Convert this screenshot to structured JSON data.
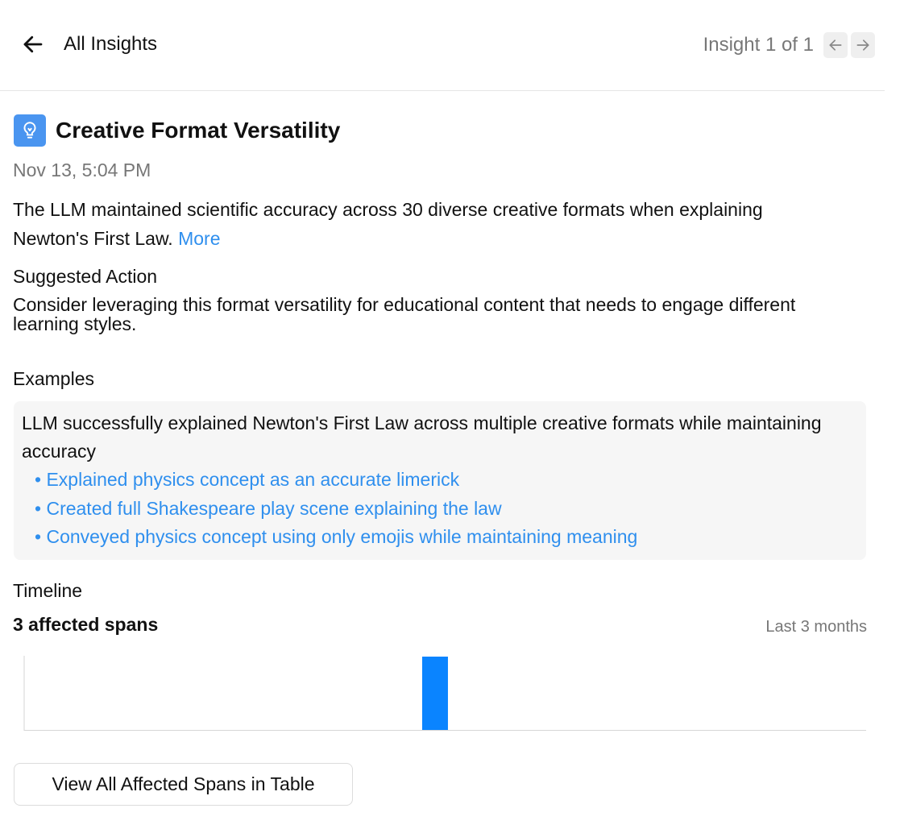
{
  "header": {
    "back_label": "All Insights",
    "pager_text": "Insight 1 of 1"
  },
  "insight": {
    "icon": "lightbulb-icon",
    "title": "Creative Format Versatility",
    "date": "Nov 13, 5:04 PM",
    "description": "The LLM maintained scientific accuracy across 30 diverse creative formats when explaining Newton's First Law.",
    "more_label": "More"
  },
  "suggested_action": {
    "heading": "Suggested Action",
    "text": "Consider leveraging this format versatility for educational content that needs to engage different learning styles."
  },
  "examples": {
    "heading": "Examples",
    "summary": "LLM successfully explained Newton's First Law across multiple creative formats while maintaining accuracy",
    "items": [
      "Explained physics concept as an accurate limerick",
      "Created full Shakespeare play scene explaining the law",
      "Conveyed physics concept using only emojis while maintaining meaning"
    ]
  },
  "timeline": {
    "heading": "Timeline",
    "count_label": "3 affected spans",
    "range_label": "Last 3 months"
  },
  "chart_data": {
    "type": "bar",
    "bar_color": "#0a84ff",
    "bars": [
      {
        "position_fraction": 0.488,
        "value": 3
      }
    ],
    "ylim": [
      0,
      3
    ]
  },
  "view_button_label": "View All Affected Spans in Table",
  "colors": {
    "link": "#2f8fee",
    "accent": "#4a95f0",
    "muted": "#777777"
  }
}
